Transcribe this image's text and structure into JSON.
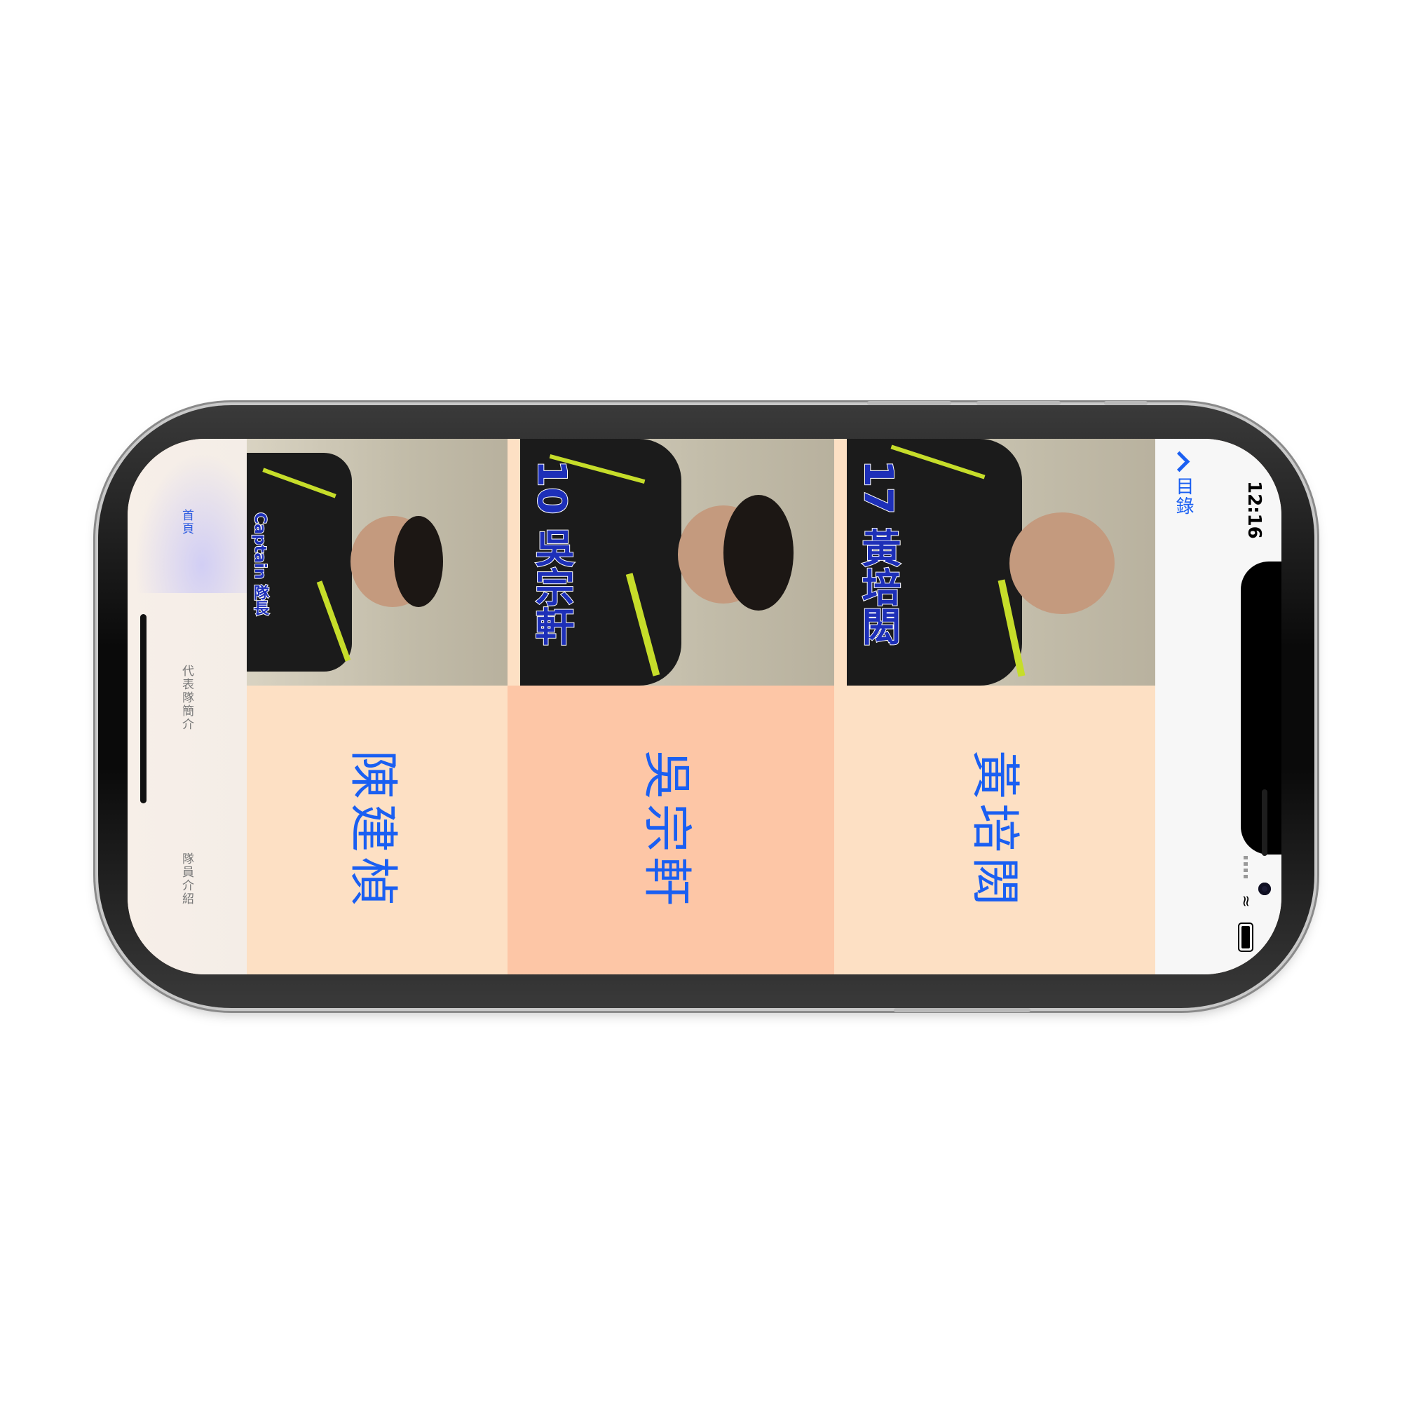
{
  "status_bar": {
    "time": "12:16",
    "wifi_icon": "wifi-icon",
    "battery_icon": "battery-icon"
  },
  "nav": {
    "back_label": "目錄",
    "back_icon": "chevron-left-icon"
  },
  "players": [
    {
      "caption": "Captain 隊長",
      "name": "陳建楨",
      "cell_color": "#fde0c4"
    },
    {
      "caption": "10 吳宗軒",
      "name": "吳宗軒",
      "cell_color": "#fdc6a6"
    },
    {
      "caption": "17 黃培閎",
      "name": "黃培閎",
      "cell_color": "#fde0c4"
    }
  ],
  "tabs": [
    {
      "label": "首頁",
      "active": true
    },
    {
      "label": "代表隊簡介",
      "active": false
    },
    {
      "label": "隊員介紹",
      "active": false
    }
  ],
  "colors": {
    "accent": "#1a5ff2",
    "caption": "#1d2fb8",
    "cell_light": "#fde0c4",
    "cell_dark": "#fdc6a6"
  }
}
